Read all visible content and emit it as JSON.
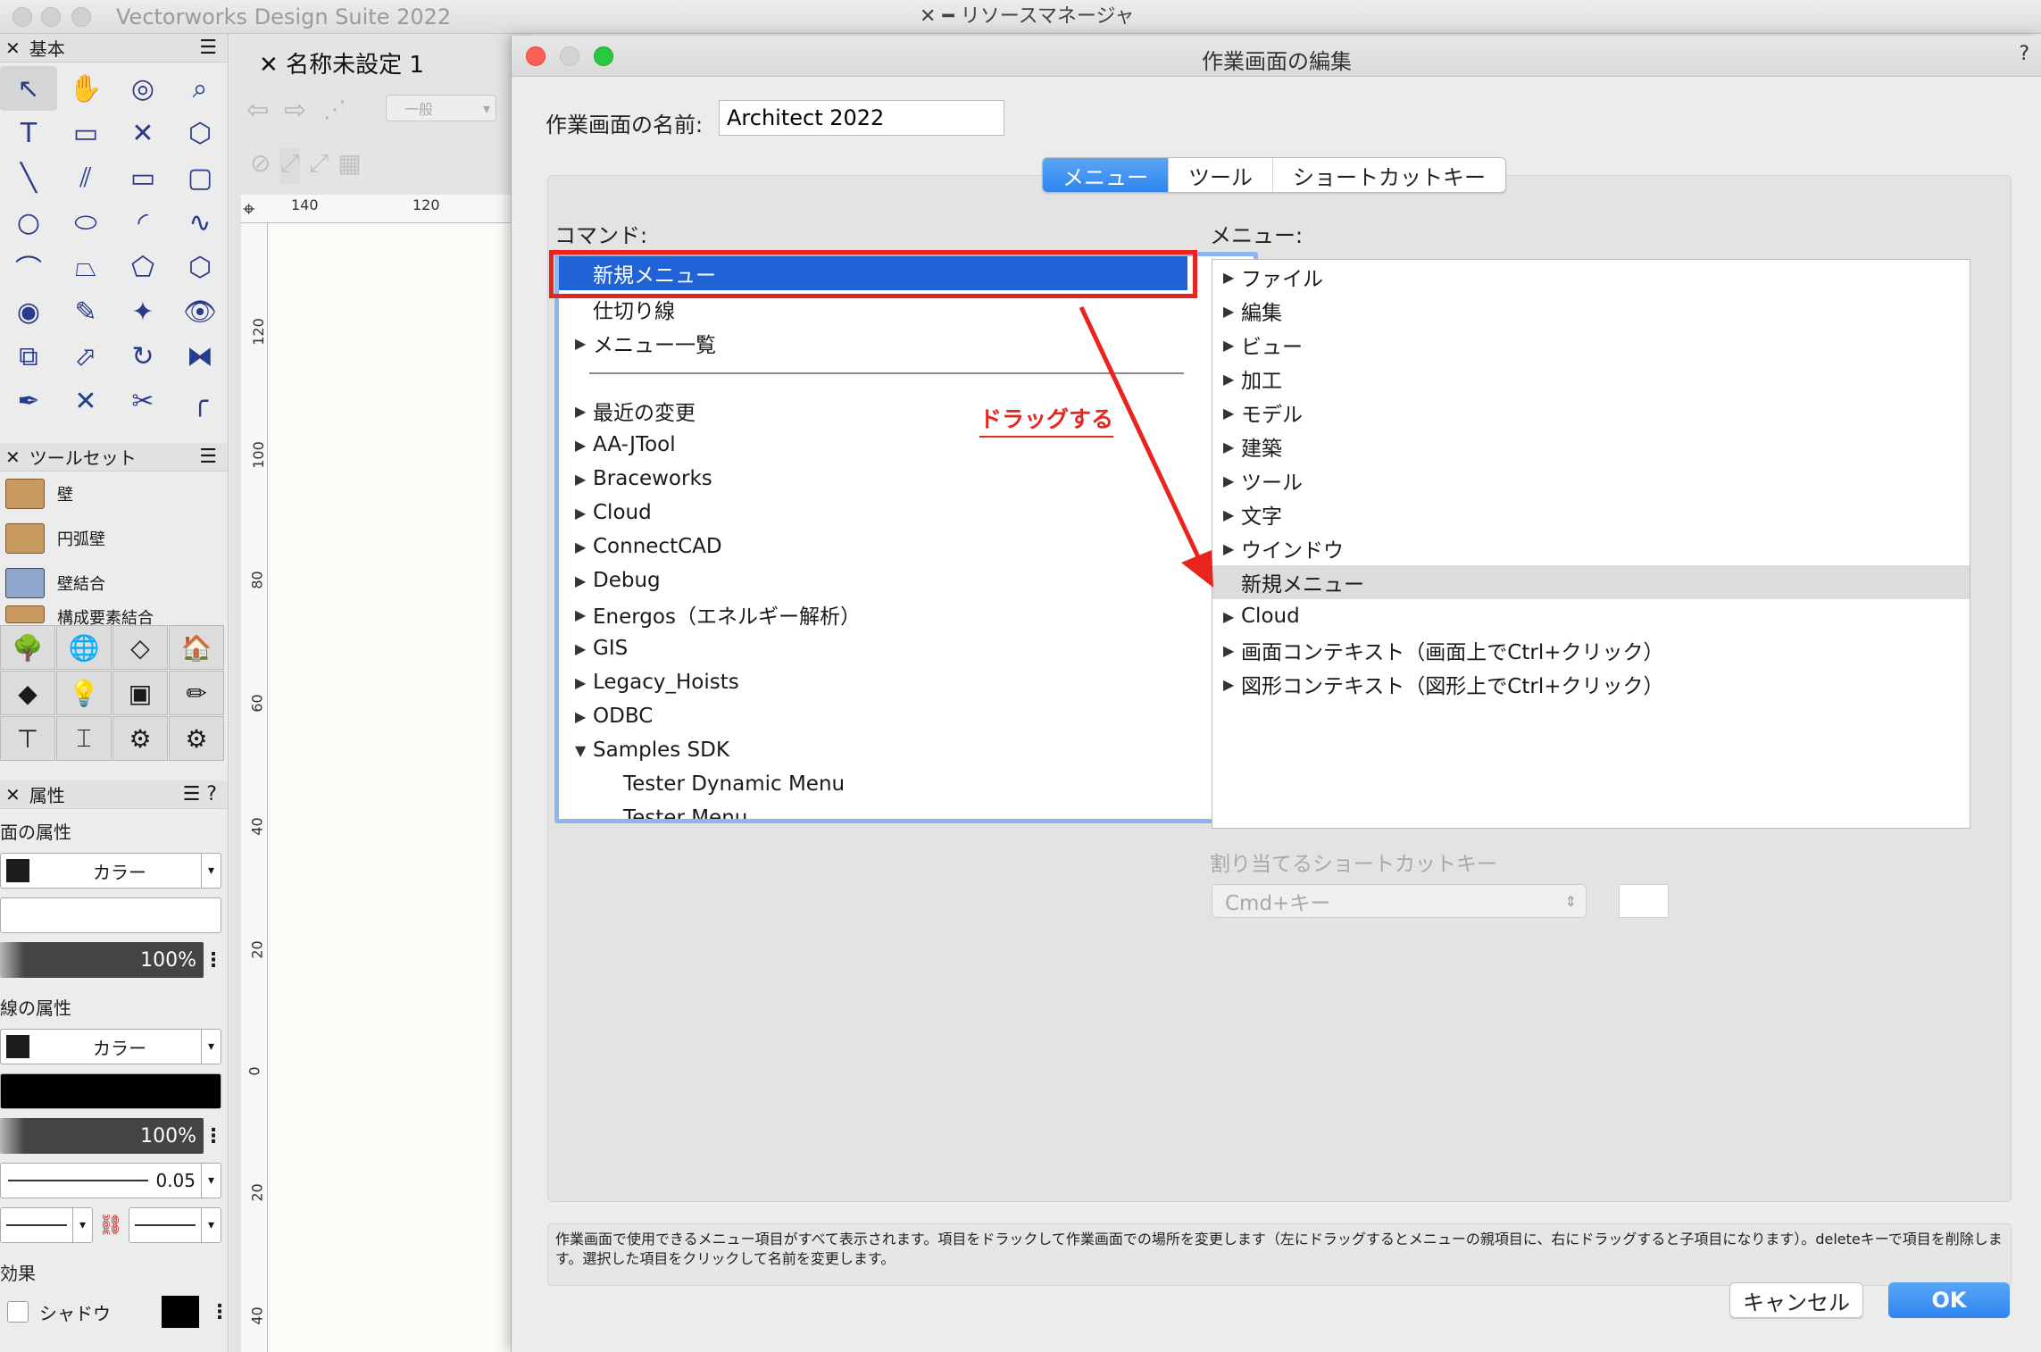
{
  "app": {
    "title": "Vectorworks Design Suite 2022",
    "resource_manager_title": "リソースマネージャ"
  },
  "palettes": {
    "basic": {
      "title": "基本"
    },
    "toolsets": {
      "title": "ツールセット",
      "items": [
        "壁",
        "円弧壁",
        "壁結合",
        "構成要素結合"
      ]
    },
    "attributes": {
      "title": "属性",
      "fill_label": "面の属性",
      "fill_mode": "カラー",
      "fill_opacity": "100%",
      "line_label": "線の属性",
      "line_mode": "カラー",
      "line_opacity": "100%",
      "line_weight": "0.05",
      "effects_label": "効果",
      "shadow_label": "シャドウ"
    }
  },
  "document": {
    "tab_title": "名称未設定 1",
    "layer_select": "一般",
    "ruler_top": [
      "140",
      "120"
    ],
    "ruler_left": [
      "120",
      "100",
      "80",
      "60",
      "40",
      "20",
      "0",
      "20",
      "40"
    ]
  },
  "dialog": {
    "title": "作業画面の編集",
    "help": "?",
    "name_label": "作業画面の名前:",
    "name_value": "Architect 2022",
    "tabs": [
      "メニュー",
      "ツール",
      "ショートカットキー"
    ],
    "active_tab": "メニュー",
    "commands_label": "コマンド:",
    "menus_label": "メニュー:",
    "commands": [
      {
        "label": "新規メニュー",
        "arrow": "",
        "indent": 0,
        "selected": true
      },
      {
        "label": "仕切り線",
        "arrow": "",
        "indent": 0
      },
      {
        "label": "メニュー一覧",
        "arrow": "▶",
        "indent": 0
      },
      {
        "label": "最近の変更",
        "arrow": "▶",
        "indent": 0
      },
      {
        "label": "AA-JTool",
        "arrow": "▶",
        "indent": 0
      },
      {
        "label": "Braceworks",
        "arrow": "▶",
        "indent": 0
      },
      {
        "label": "Cloud",
        "arrow": "▶",
        "indent": 0
      },
      {
        "label": "ConnectCAD",
        "arrow": "▶",
        "indent": 0
      },
      {
        "label": "Debug",
        "arrow": "▶",
        "indent": 0
      },
      {
        "label": "Energos（エネルギー解析）",
        "arrow": "▶",
        "indent": 0
      },
      {
        "label": "GIS",
        "arrow": "▶",
        "indent": 0
      },
      {
        "label": "Legacy_Hoists",
        "arrow": "▶",
        "indent": 0
      },
      {
        "label": "ODBC",
        "arrow": "▶",
        "indent": 0
      },
      {
        "label": "Samples SDK",
        "arrow": "▼",
        "indent": 0
      },
      {
        "label": "Tester Dynamic Menu",
        "arrow": "",
        "indent": 1
      },
      {
        "label": "Tester Menu",
        "arrow": "",
        "indent": 1
      }
    ],
    "menus": [
      {
        "label": "ファイル",
        "arrow": "▶"
      },
      {
        "label": "編集",
        "arrow": "▶"
      },
      {
        "label": "ビュー",
        "arrow": "▶"
      },
      {
        "label": "加工",
        "arrow": "▶"
      },
      {
        "label": "モデル",
        "arrow": "▶"
      },
      {
        "label": "建築",
        "arrow": "▶"
      },
      {
        "label": "ツール",
        "arrow": "▶"
      },
      {
        "label": "文字",
        "arrow": "▶"
      },
      {
        "label": "ウインドウ",
        "arrow": "▶"
      },
      {
        "label": "新規メニュー",
        "arrow": "",
        "highlighted": true
      },
      {
        "label": "Cloud",
        "arrow": "▶"
      },
      {
        "label": "画面コンテキスト（画面上でCtrl+クリック）",
        "arrow": "▶"
      },
      {
        "label": "図形コンテキスト（図形上でCtrl+クリック）",
        "arrow": "▶"
      }
    ],
    "annotation": "ドラッグする",
    "shortcut_label": "割り当てるショートカットキー",
    "shortcut_select": "Cmd+キー",
    "description": "作業画面で使用できるメニュー項目がすべて表示されます。項目をドラックして作業画面での場所を変更します（左にドラッグするとメニューの親項目に、右にドラッグすると子項目になります）。deleteキーで項目を削除します。選択した項目をクリックして名前を変更します。",
    "cancel_label": "キャンセル",
    "ok_label": "OK"
  },
  "colors": {
    "accent": "#2f86ef",
    "selection": "#1f63d6",
    "annotation_red": "#e6271f"
  }
}
